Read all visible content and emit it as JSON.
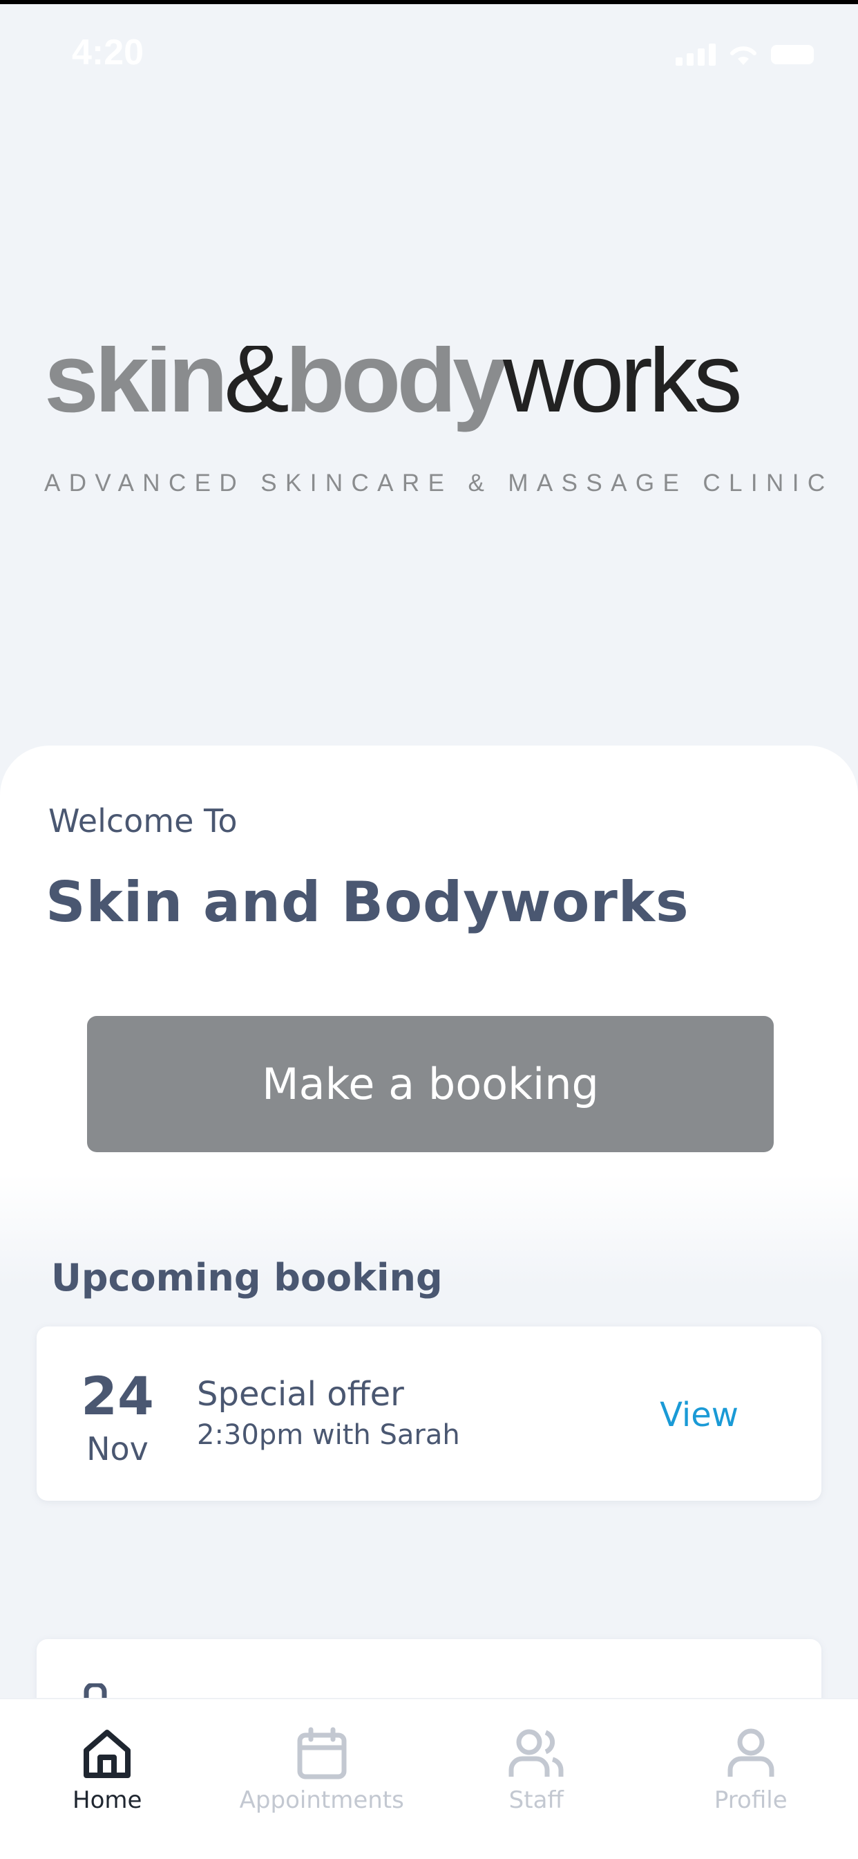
{
  "status_bar": {
    "time": "4:20",
    "icons": [
      "signal-icon",
      "wifi-icon",
      "battery-icon"
    ]
  },
  "logo": {
    "word_skin": "skin",
    "ampersand": "&",
    "word_body": "body",
    "word_works": "works",
    "tagline": "ADVANCED SKINCARE & MASSAGE CLINIC"
  },
  "hero": {
    "welcome": "Welcome To",
    "title": "Skin and Bodyworks",
    "cta_label": "Make a booking"
  },
  "upcoming": {
    "section_title": "Upcoming booking",
    "booking": {
      "day": "24",
      "month": "Nov",
      "title": "Special offer",
      "subtitle": "2:30pm with Sarah",
      "action": "View"
    }
  },
  "nav": {
    "items": [
      {
        "label": "Home",
        "icon": "home-icon",
        "active": true
      },
      {
        "label": "Appointments",
        "icon": "calendar-icon",
        "active": false
      },
      {
        "label": "Staff",
        "icon": "users-icon",
        "active": false
      },
      {
        "label": "Profile",
        "icon": "user-icon",
        "active": false
      }
    ]
  },
  "colors": {
    "background": "#f1f4f8",
    "text": "#4a5771",
    "button": "#888b8e",
    "link": "#1a9ad6",
    "logo_gray": "#8a8c8e",
    "logo_dark": "#222222",
    "nav_active": "#1f2630",
    "nav_inactive": "#c3c8d1"
  }
}
